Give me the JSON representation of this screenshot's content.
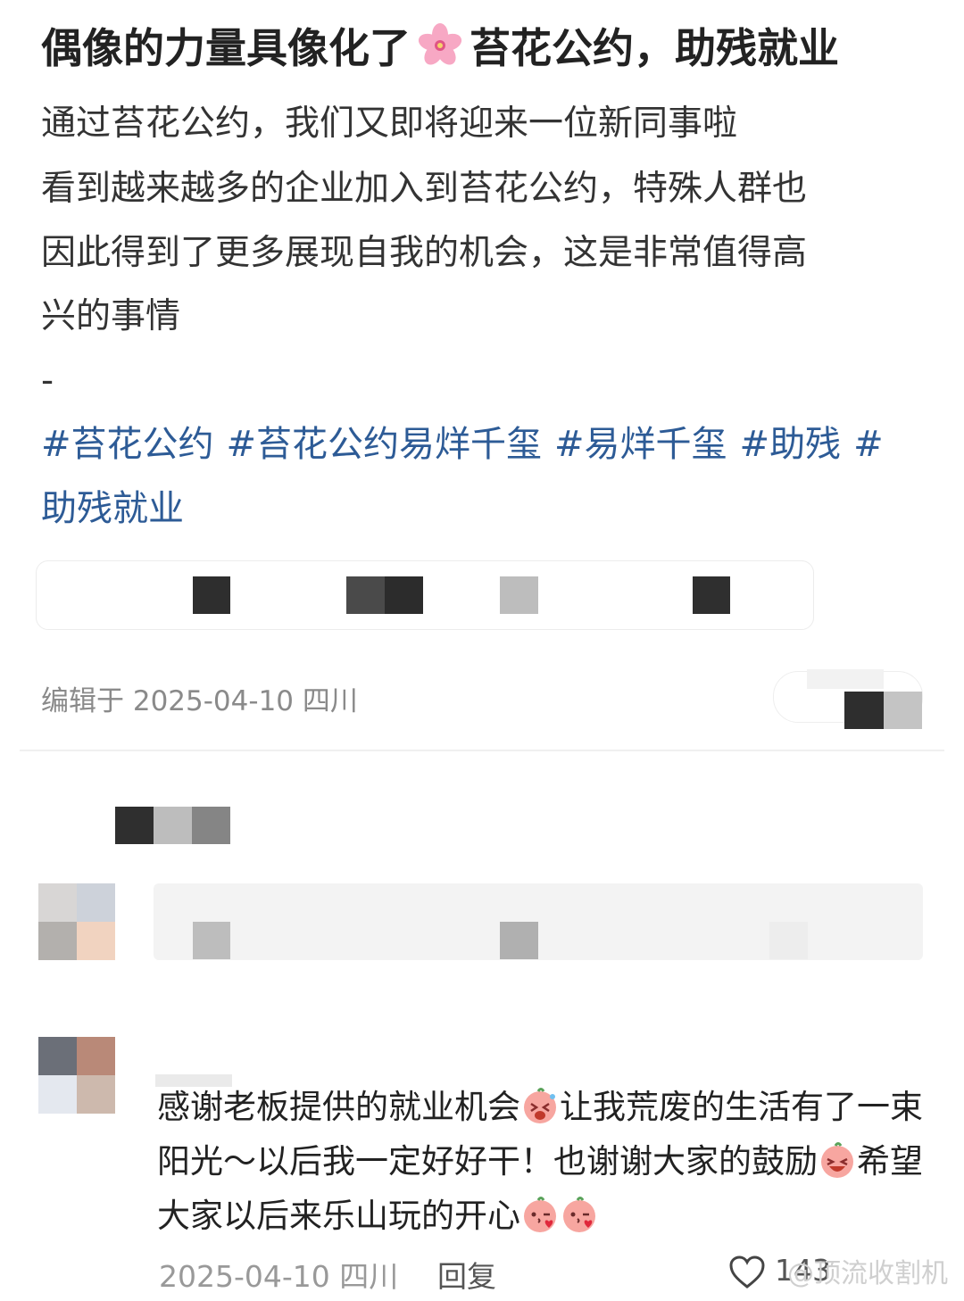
{
  "post": {
    "title_part1": "偶像的力量具像化了",
    "title_part2": "苔花公约，助残就业",
    "body_lines": [
      "通过苔花公约，我们又即将迎来一位新同事啦",
      "看到越来越多的企业加入到苔花公约，特殊人群也",
      "因此得到了更多展现自我的机会，这是非常值得高",
      "兴的事情",
      "-"
    ],
    "tags": [
      "#苔花公约",
      "#苔花公约易烊千玺",
      "#易烊千玺",
      "#助残",
      "#"
    ],
    "tags_line2": "助残就业",
    "edited_meta": "编辑于 2025-04-10 四川"
  },
  "comment": {
    "text_part1": "感谢老板提供的就业机会",
    "text_part2": "让我荒废的生活有了一束阳光～以后我一定好好干！也谢谢大家的鼓励",
    "text_part3": "希望大家以后来乐山玩的开心",
    "date": "2025-04-10 四川",
    "reply_label": "回复",
    "like_count": "143",
    "watermark": "@顶流收割机"
  },
  "colors": {
    "tag": "#2d5b96",
    "meta": "#8a8a8a",
    "divider": "#f0f0f0"
  },
  "icons": [
    "cherry-blossom-icon",
    "crying-face-emoji-icon",
    "laughing-face-emoji-icon",
    "kiss-face-emoji-icon",
    "heart-outline-icon"
  ]
}
